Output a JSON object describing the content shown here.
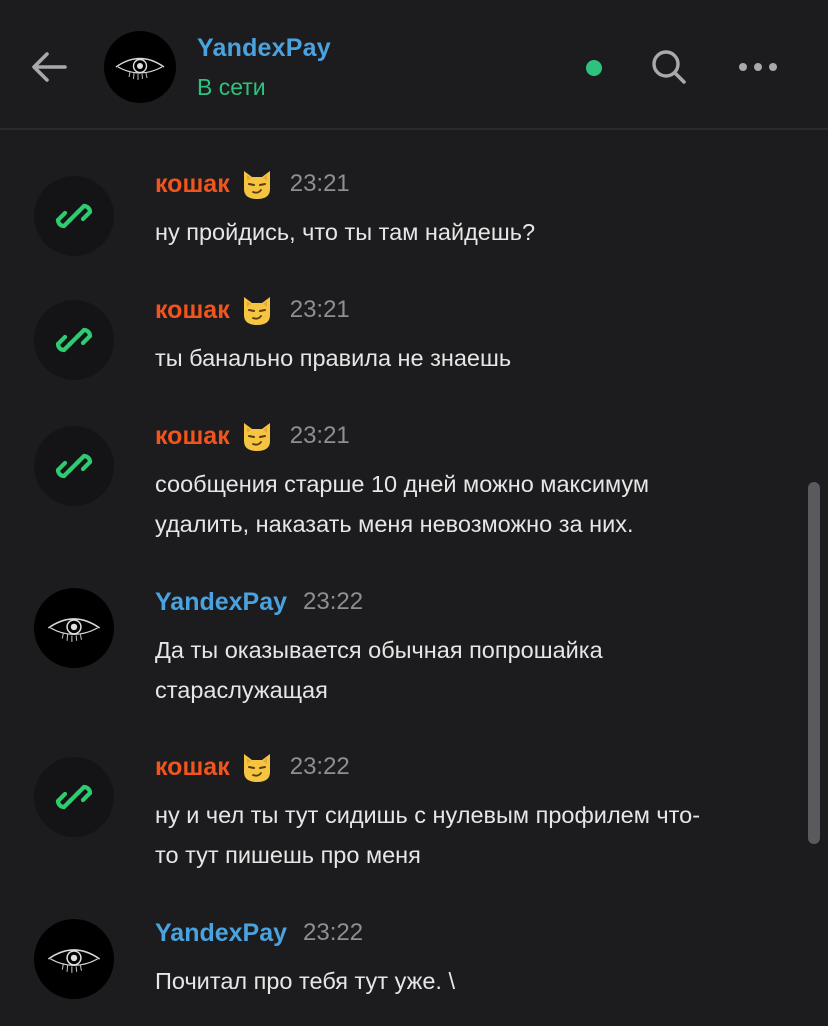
{
  "header": {
    "title": "YandexPay",
    "status": "В сети",
    "icons": {
      "back": "arrow-left-icon",
      "search": "search-icon",
      "more": "more-horizontal-icon"
    }
  },
  "colors": {
    "background": "#1c1c1e",
    "accent_blue": "#4aa3df",
    "online_green": "#2ec27e",
    "author_orange": "#f2541d",
    "link_green": "#2ecc71"
  },
  "messages": [
    {
      "author": "кошак",
      "time": "23:21",
      "lines": [
        "ну пройдись, что ты там найдешь?"
      ]
    },
    {
      "author": "кошак",
      "time": "23:21",
      "lines": [
        "ты банально правила не знаешь"
      ]
    },
    {
      "author": "кошак",
      "time": "23:21",
      "lines": [
        "сообщения старше 10 дней можно максимум",
        "удалить, наказать меня невозможно за них."
      ]
    },
    {
      "author": "YandexPay",
      "time": "23:22",
      "lines": [
        "Да ты оказывается обычная попрошайка",
        "стараслужащая"
      ]
    },
    {
      "author": "кошак",
      "time": "23:22",
      "lines": [
        "ну и чел ты тут сидишь с нулевым профилем что-",
        "то тут пишешь про меня"
      ]
    },
    {
      "author": "YandexPay",
      "time": "23:22",
      "lines": [
        "Почитал про тебя тут уже. \\"
      ]
    }
  ]
}
